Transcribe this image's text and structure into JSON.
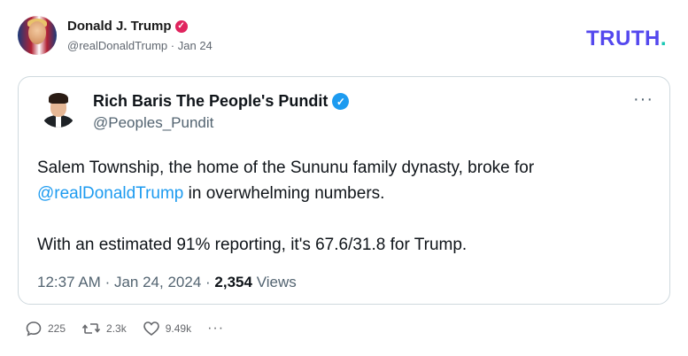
{
  "post": {
    "author_name": "Donald J. Trump",
    "handle": "@realDonaldTrump",
    "separator": "·",
    "date": "Jan 24",
    "badge_icon": "verified-badge-icon"
  },
  "brand": {
    "logo_text": "TRUTH",
    "logo_dot": ".",
    "color": "#5448ee",
    "dot_color": "#17c7b3"
  },
  "embedded_tweet": {
    "name": "Rich Baris The People's Pundit",
    "handle": "@Peoples_Pundit",
    "more_icon": "···",
    "text_before_mention": "Salem Township, the home of the Sununu family dynasty, broke for",
    "mention": "@realDonaldTrump",
    "text_after_mention": " in overwhelming numbers.",
    "text_para2": "With an estimated 91% reporting, it's 67.6/31.8 for Trump.",
    "time": "12:37 AM",
    "meta_sep": "·",
    "date": "Jan 24, 2024",
    "views_count": "2,354",
    "views_label": "Views",
    "accent": "#1d9bf0"
  },
  "actions": {
    "replies": "225",
    "retruths": "2.3k",
    "likes": "9.49k",
    "more": "···"
  }
}
